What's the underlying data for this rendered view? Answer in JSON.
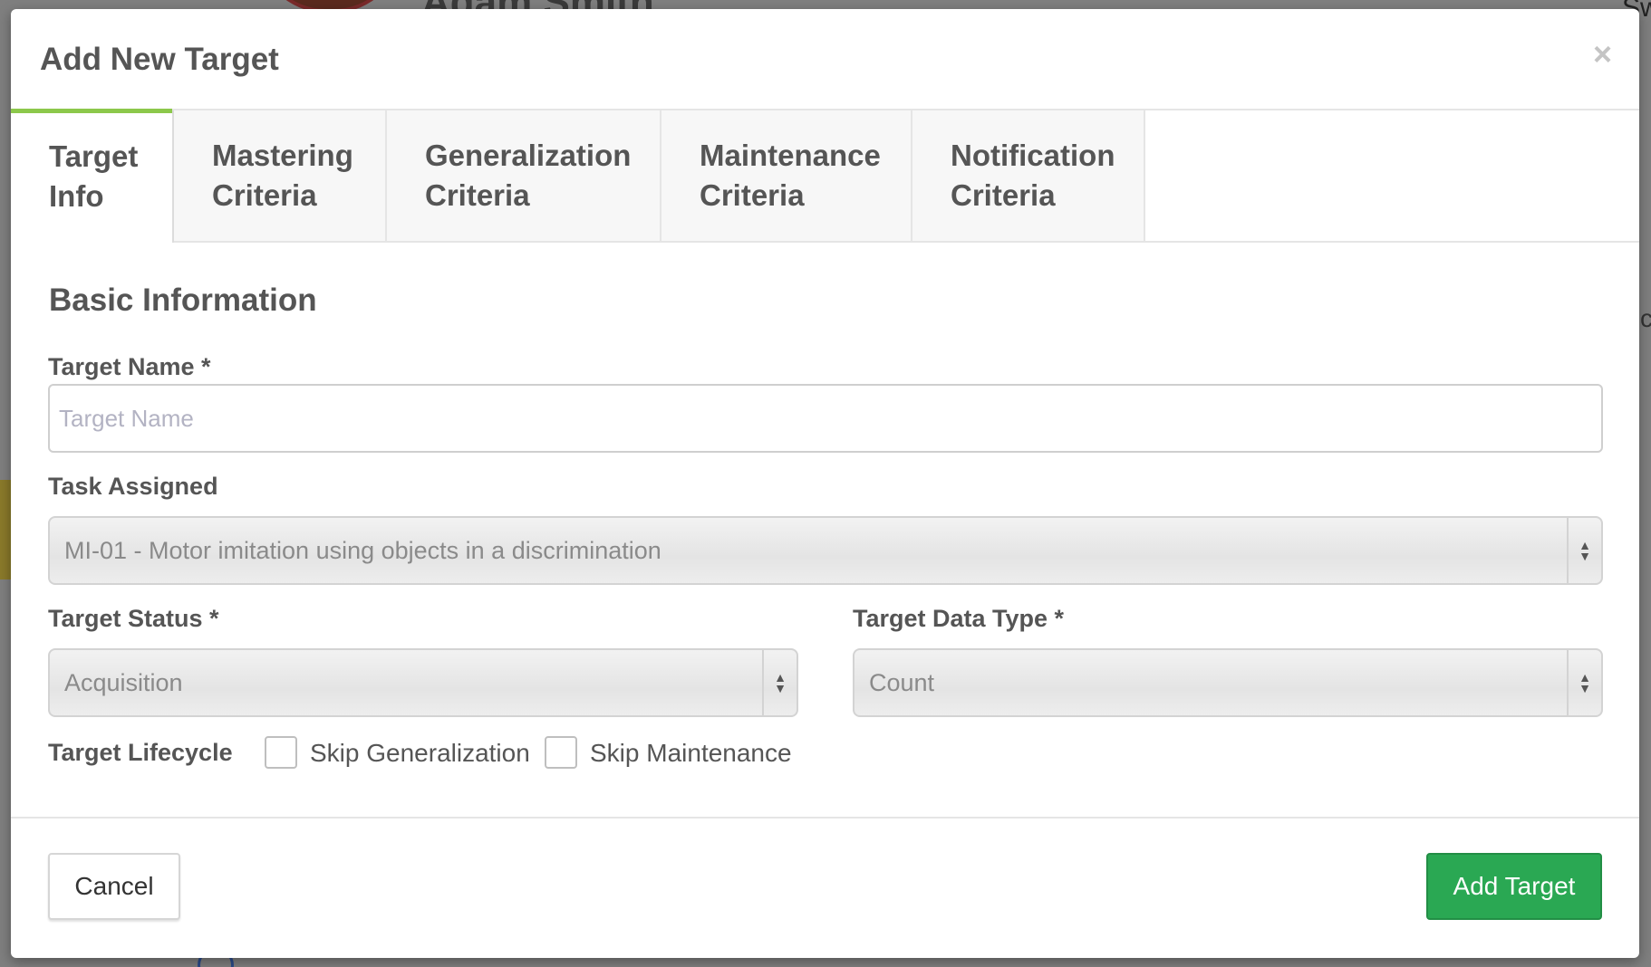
{
  "background": {
    "name_partial": "Adam Smith",
    "corner_text": "Sw",
    "side_text": "c"
  },
  "modal": {
    "title": "Add New Target",
    "close_glyph": "×"
  },
  "tabs": [
    {
      "line1": "Target",
      "line2": "Info",
      "active": true
    },
    {
      "line1": "Mastering",
      "line2": "Criteria",
      "active": false
    },
    {
      "line1": "Generalization",
      "line2": "Criteria",
      "active": false
    },
    {
      "line1": "Maintenance",
      "line2": "Criteria",
      "active": false
    },
    {
      "line1": "Notification",
      "line2": "Criteria",
      "active": false
    }
  ],
  "form": {
    "section_title": "Basic Information",
    "target_name": {
      "label": "Target Name *",
      "placeholder": "Target Name",
      "value": ""
    },
    "task_assigned": {
      "label": "Task Assigned",
      "value": "MI-01 - Motor imitation using objects in a discrimination"
    },
    "target_status": {
      "label": "Target Status *",
      "value": "Acquisition"
    },
    "target_data_type": {
      "label": "Target Data Type *",
      "value": "Count"
    },
    "lifecycle": {
      "label": "Target Lifecycle",
      "skip_generalization": {
        "label": "Skip Generalization",
        "checked": false
      },
      "skip_maintenance": {
        "label": "Skip Maintenance",
        "checked": false
      }
    }
  },
  "footer": {
    "cancel_label": "Cancel",
    "add_label": "Add Target"
  },
  "colors": {
    "active_tab_accent": "#8cc84b",
    "primary_button": "#2aa853",
    "text": "#555555"
  }
}
